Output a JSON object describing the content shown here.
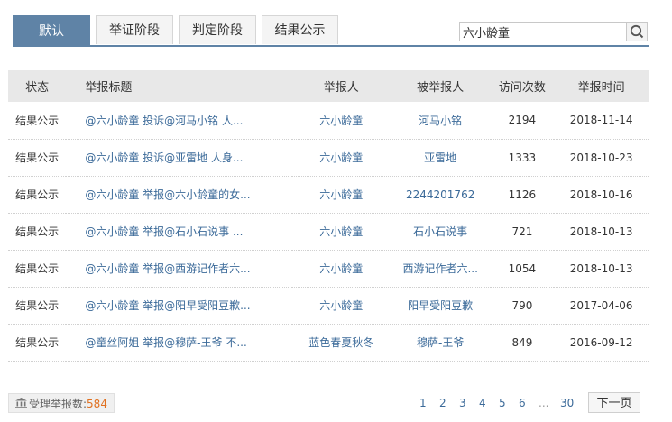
{
  "tabs": [
    {
      "label": "默认"
    },
    {
      "label": "举证阶段"
    },
    {
      "label": "判定阶段"
    },
    {
      "label": "结果公示"
    }
  ],
  "search": {
    "value": "六小龄童",
    "icon": "search-icon"
  },
  "table": {
    "headers": {
      "status": "状态",
      "title": "举报标题",
      "reporter": "举报人",
      "accused": "被举报人",
      "visits": "访问次数",
      "time": "举报时间"
    },
    "rows": [
      {
        "status": "结果公示",
        "title": "@六小龄童 投诉@河马小铭 人...",
        "reporter": "六小龄童",
        "accused": "河马小铭",
        "visits": "2194",
        "time": "2018-11-14"
      },
      {
        "status": "结果公示",
        "title": "@六小龄童 投诉@亚雷地 人身...",
        "reporter": "六小龄童",
        "accused": "亚雷地",
        "visits": "1333",
        "time": "2018-10-23"
      },
      {
        "status": "结果公示",
        "title": "@六小龄童 举报@六小龄童的女...",
        "reporter": "六小龄童",
        "accused": "2244201762",
        "visits": "1126",
        "time": "2018-10-16"
      },
      {
        "status": "结果公示",
        "title": "@六小龄童 举报@石小石说事 ...",
        "reporter": "六小龄童",
        "accused": "石小石说事",
        "visits": "721",
        "time": "2018-10-13"
      },
      {
        "status": "结果公示",
        "title": "@六小龄童 举报@西游记作者六...",
        "reporter": "六小龄童",
        "accused": "西游记作者六...",
        "visits": "1054",
        "time": "2018-10-13"
      },
      {
        "status": "结果公示",
        "title": "@六小龄童 举报@阳早受阳豆歉...",
        "reporter": "六小龄童",
        "accused": "阳早受阳豆歉",
        "visits": "790",
        "time": "2017-04-06"
      },
      {
        "status": "结果公示",
        "title": "@童丝阿姐 举报@穆萨-王爷 不...",
        "reporter": "蓝色春夏秋冬",
        "accused": "穆萨-王爷",
        "visits": "849",
        "time": "2016-09-12"
      }
    ]
  },
  "footer": {
    "stat_label": "受理举报数:",
    "stat_count": "584",
    "pages": [
      "1",
      "2",
      "3",
      "4",
      "5",
      "6",
      "...",
      "30"
    ],
    "next_label": "下一页"
  },
  "colors": {
    "accent": "#5f83a6",
    "link": "#3b6a99",
    "count": "#e07020"
  }
}
